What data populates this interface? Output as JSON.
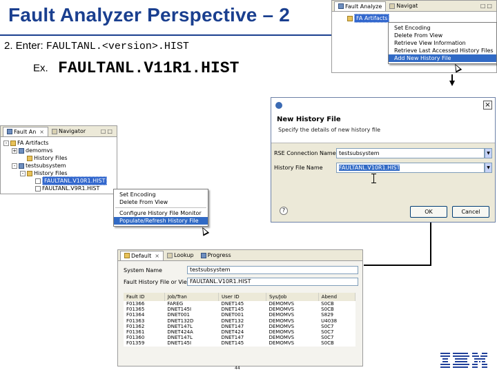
{
  "slide": {
    "title": "Fault Analyzer Perspective – 2",
    "step_label": "2. Enter:",
    "step_value": "FAULTANL.<version>.HIST",
    "example_label": "Ex.",
    "example_value": "FAULTANL.V11R1.HIST",
    "page_number": "44",
    "logo": "IBM"
  },
  "top_snippet": {
    "tabs": [
      {
        "label": "Fault Analyze",
        "icon": "fault-analyzer-view-icon"
      },
      {
        "label": "Navigat",
        "icon": "navigator-view-icon"
      }
    ],
    "tree_root": "FA Artifacts",
    "menu_items": [
      "Set Encoding",
      "Delete From View",
      "Retrieve View Information",
      "Retrieve Last Accessed History Files",
      "Add New History File"
    ],
    "highlighted_index": 4
  },
  "artifacts_view": {
    "tabs": [
      {
        "label": "Fault An",
        "icon": "fault-analyzer-view-icon"
      },
      {
        "label": "Navigator",
        "icon": "navigator-view-icon"
      }
    ],
    "tree": [
      {
        "label": "FA Artifacts",
        "level": 0,
        "icon": "folder-icon",
        "toggle": "-"
      },
      {
        "label": "demomvs",
        "level": 1,
        "icon": "system-icon",
        "toggle": "+"
      },
      {
        "label": "History Files",
        "level": 2,
        "icon": "folder-icon",
        "toggle": ""
      },
      {
        "label": "testsubsystem",
        "level": 1,
        "icon": "system-icon",
        "toggle": "-"
      },
      {
        "label": "History Files",
        "level": 2,
        "icon": "folder-icon",
        "toggle": "-"
      },
      {
        "label": "FAULTANL.V10R1.HIST",
        "level": 3,
        "icon": "history-file-icon",
        "toggle": "",
        "selected": true
      },
      {
        "label": "FAULTANL.V9R1.HIST",
        "level": 3,
        "icon": "history-file-icon",
        "toggle": ""
      }
    ]
  },
  "context_menu": {
    "items": [
      "Set Encoding",
      "Delete From View",
      "Configure History File Monitor",
      "Populate/Refresh History File"
    ],
    "highlighted_index": 3
  },
  "dialog": {
    "title": "New History File",
    "subtitle": "Specify the details of new history file",
    "rse_label": "RSE Connection Name",
    "rse_value": "testsubsystem",
    "history_label": "History File Name",
    "history_value": "FAULTANL.V10R1.HIST",
    "ok": "OK",
    "cancel": "Cancel",
    "help_icon": "help-icon"
  },
  "fault_view": {
    "tabs": [
      {
        "label": "Default",
        "icon": "default-view-icon"
      },
      {
        "label": "Lookup",
        "icon": "lookup-view-icon"
      },
      {
        "label": "Progress",
        "icon": "progress-view-icon"
      }
    ],
    "system_name_label": "System Name",
    "system_name_value": "testsubsystem",
    "history_label": "Fault History File or View",
    "history_value": "FAULTANL.V10R1.HIST",
    "columns": [
      "Fault ID",
      "Job/Tran",
      "User ID",
      "Sys/Job",
      "Abend"
    ],
    "rows": [
      [
        "F01366",
        "FAREG",
        "DNET145",
        "DEMOMVS",
        "S0CB"
      ],
      [
        "F01365",
        "DNET145I",
        "DNET145",
        "DEMOMVS",
        "S0CB"
      ],
      [
        "F01364",
        "DNET001",
        "DNET001",
        "DEMOMVS",
        "S829"
      ],
      [
        "F01363",
        "DNET132D",
        "DNET132",
        "DEMOMVS",
        "U4038"
      ],
      [
        "F01362",
        "DNET147L",
        "DNET147",
        "DEMOMVS",
        "S0C7"
      ],
      [
        "F01361",
        "DNET424A",
        "DNET424",
        "DEMOMVS",
        "S0C7"
      ],
      [
        "F01360",
        "DNET147L",
        "DNET147",
        "DEMOMVS",
        "S0C7"
      ],
      [
        "F01359",
        "DNET145I",
        "DNET145",
        "DEMOMVS",
        "S0CB"
      ]
    ]
  },
  "colors": {
    "title": "#1a3f8f",
    "selection": "#316ac5",
    "ibm_blue": "#1f3f99"
  }
}
